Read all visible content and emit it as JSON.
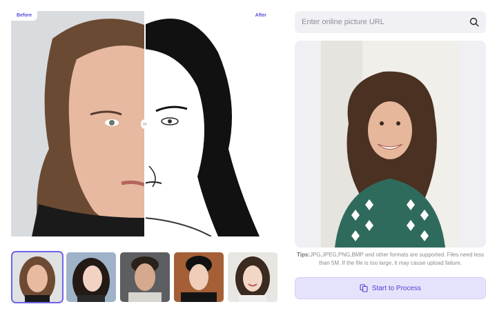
{
  "comparison": {
    "before_label": "Before",
    "after_label": "After",
    "handle_glyph": "‹›"
  },
  "thumbnails": [
    {
      "name": "portrait-woman-brown-hair",
      "selected": true
    },
    {
      "name": "portrait-woman-black-hair",
      "selected": false
    },
    {
      "name": "portrait-man-dark-hair",
      "selected": false
    },
    {
      "name": "portrait-man-black-hair",
      "selected": false
    },
    {
      "name": "portrait-woman-smiling",
      "selected": false
    }
  ],
  "search": {
    "placeholder": "Enter online picture URL",
    "value": "",
    "icon": "search-icon"
  },
  "tips": {
    "label": "Tips:",
    "text": "JPG,JPEG,PNG,BMP and other formats are supported. Files need less than 5M. If the file is too large, it may cause upload failure."
  },
  "process_button": {
    "label": "Start to Process",
    "icon": "copy-icon"
  },
  "colors": {
    "accent": "#5a4fd6",
    "button_bg": "#e5e3fb",
    "panel_bg": "#efeff4"
  }
}
